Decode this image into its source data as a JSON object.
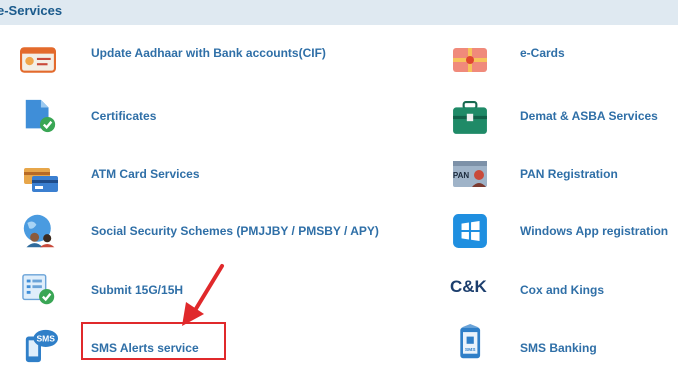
{
  "header": {
    "title": "e-Services"
  },
  "colors": {
    "link": "#2f6fa7",
    "header_bg": "#dfe9f1",
    "header_text": "#1a5a8c",
    "highlight": "#e0292b"
  },
  "services_left": [
    {
      "label": "Update Aadhaar with Bank accounts(CIF)",
      "icon": "aadhaar-card-icon"
    },
    {
      "label": "Certificates",
      "icon": "certificate-document-icon"
    },
    {
      "label": "ATM Card Services",
      "icon": "atm-cards-icon"
    },
    {
      "label": "Social Security Schemes (PMJJBY / PMSBY / APY)",
      "icon": "social-security-globe-icon"
    },
    {
      "label": "Submit 15G/15H",
      "icon": "form-check-icon"
    },
    {
      "label": "SMS Alerts service",
      "icon": "sms-phone-icon"
    }
  ],
  "services_right": [
    {
      "label": "e-Cards",
      "icon": "gift-card-icon"
    },
    {
      "label": "Demat & ASBA Services",
      "icon": "briefcase-icon"
    },
    {
      "label": "PAN Registration",
      "icon": "pan-card-icon"
    },
    {
      "label": "Windows App registration",
      "icon": "windows-logo-icon"
    },
    {
      "label": "Cox and Kings",
      "icon": "cox-kings-logo-icon",
      "logo_text": "C&K"
    },
    {
      "label": "SMS Banking",
      "icon": "sms-banking-phone-icon",
      "icon_text": "SMS"
    }
  ],
  "sms_icon_text": "SMS",
  "pan_icon_text": "PAN"
}
